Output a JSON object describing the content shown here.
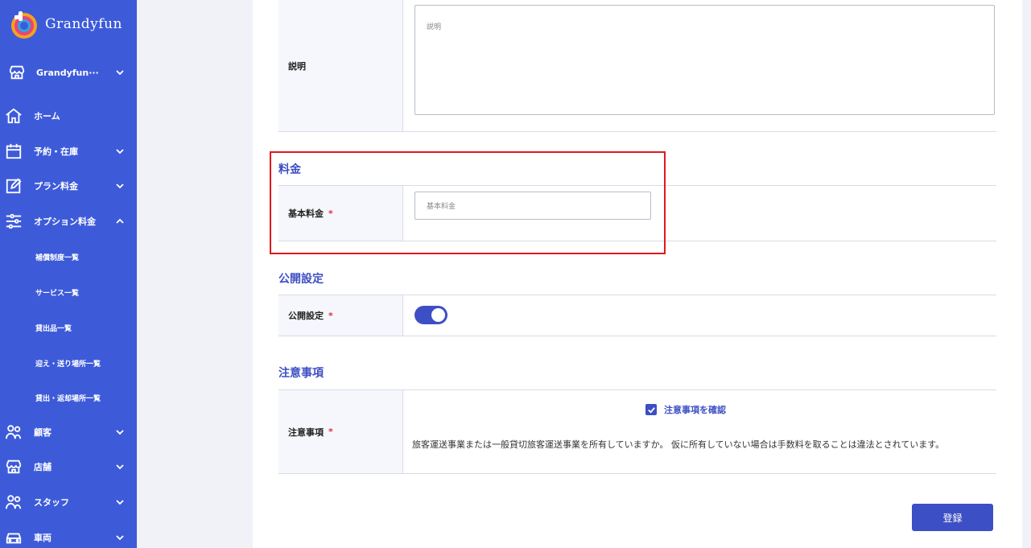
{
  "brand": {
    "name": "Grandyfun"
  },
  "sidebar": {
    "shop": "Grandyfun···",
    "items": [
      {
        "label": "ホーム",
        "icon": "home-icon"
      },
      {
        "label": "予約・在庫",
        "icon": "calendar-icon"
      },
      {
        "label": "プラン料金",
        "icon": "edit-icon"
      },
      {
        "label": "オプション料金",
        "icon": "sliders-icon"
      },
      {
        "label": "顧客",
        "icon": "users-icon"
      },
      {
        "label": "店舗",
        "icon": "store-icon"
      },
      {
        "label": "スタッフ",
        "icon": "staff-icon"
      },
      {
        "label": "車両",
        "icon": "car-icon"
      }
    ],
    "subitems": [
      "補償制度一覧",
      "サービス一覧",
      "貸出品一覧",
      "迎え・送り場所一覧",
      "貸出・返却場所一覧"
    ]
  },
  "form": {
    "description": {
      "label": "説明",
      "placeholder": "説明"
    },
    "pricing": {
      "section": "料金",
      "label": "基本料金",
      "placeholder": "基本料金"
    },
    "publish": {
      "section": "公開設定",
      "label": "公開設定",
      "enabled": true
    },
    "notes": {
      "section": "注意事項",
      "label": "注意事項",
      "checkbox_label": "注意事項を確認",
      "checked": true,
      "text": "旅客運送事業または一般貸切旅客運送事業を所有していますか。 仮に所有していない場合は手数料を取ることは違法とされています。"
    },
    "required_mark": "*",
    "submit_label": "登録"
  },
  "colors": {
    "sidebar": "#3d5bd9",
    "accent": "#3d4fc4",
    "required": "#e0313a",
    "highlight": "#e0191e"
  }
}
